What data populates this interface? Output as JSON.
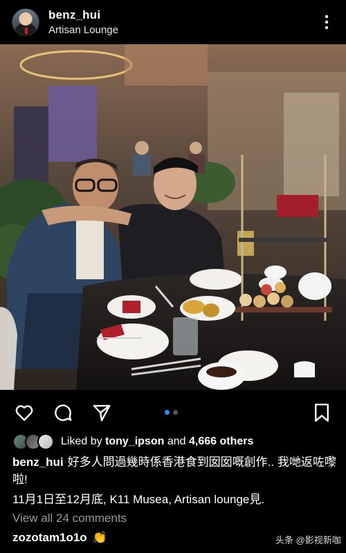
{
  "post": {
    "username": "benz_hui",
    "location": "Artisan Lounge"
  },
  "icons": {
    "more": "more-vertical-icon",
    "like": "heart-icon",
    "comment": "comment-icon",
    "share": "send-icon",
    "save": "bookmark-icon"
  },
  "carousel": {
    "count": 2,
    "active": 1
  },
  "likes": {
    "prefix": "Liked by ",
    "user": "tony_ipson",
    "middle": " and ",
    "count": "4,666 others"
  },
  "caption": {
    "username": "benz_hui",
    "text": "好多人問過幾時係香港食到囡囡嘅創作.. 我哋返咗嚟啦!",
    "line2": "11月1日至12月底, K11 Musea, Artisan lounge見."
  },
  "comments": {
    "view_all": "View all 24 comments",
    "first_user": "zozotam1o1o",
    "first_text": "👏"
  },
  "watermark": "头条 @影视新咖"
}
